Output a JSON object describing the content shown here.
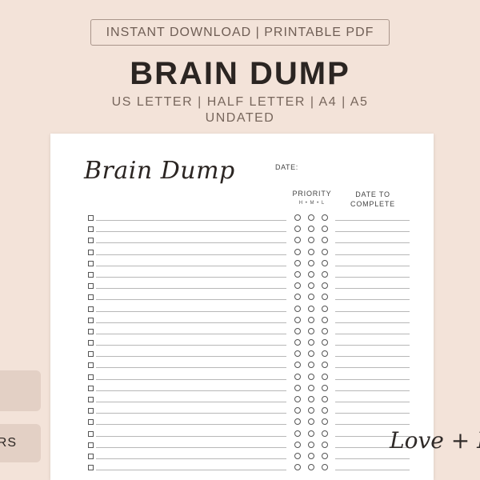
{
  "header": {
    "badge": "INSTANT DOWNLOAD | PRINTABLE PDF",
    "title": "BRAIN DUMP",
    "sizes_line1": "US LETTER | HALF LETTER | A4 | A5",
    "sizes_line2": "UNDATED"
  },
  "sheet": {
    "title": "Brain Dump",
    "date_label": "DATE:",
    "priority_label": "PRIORITY",
    "priority_levels": "H • M • L",
    "due_label_line1": "DATE TO",
    "due_label_line2": "COMPLETE",
    "row_count": 23
  },
  "side": {
    "tab2_text": "RS"
  },
  "brand": {
    "signature": "Love + Pa"
  },
  "colors": {
    "background": "#f3e3d9",
    "text": "#2b2522",
    "tab": "#e3d0c5"
  }
}
